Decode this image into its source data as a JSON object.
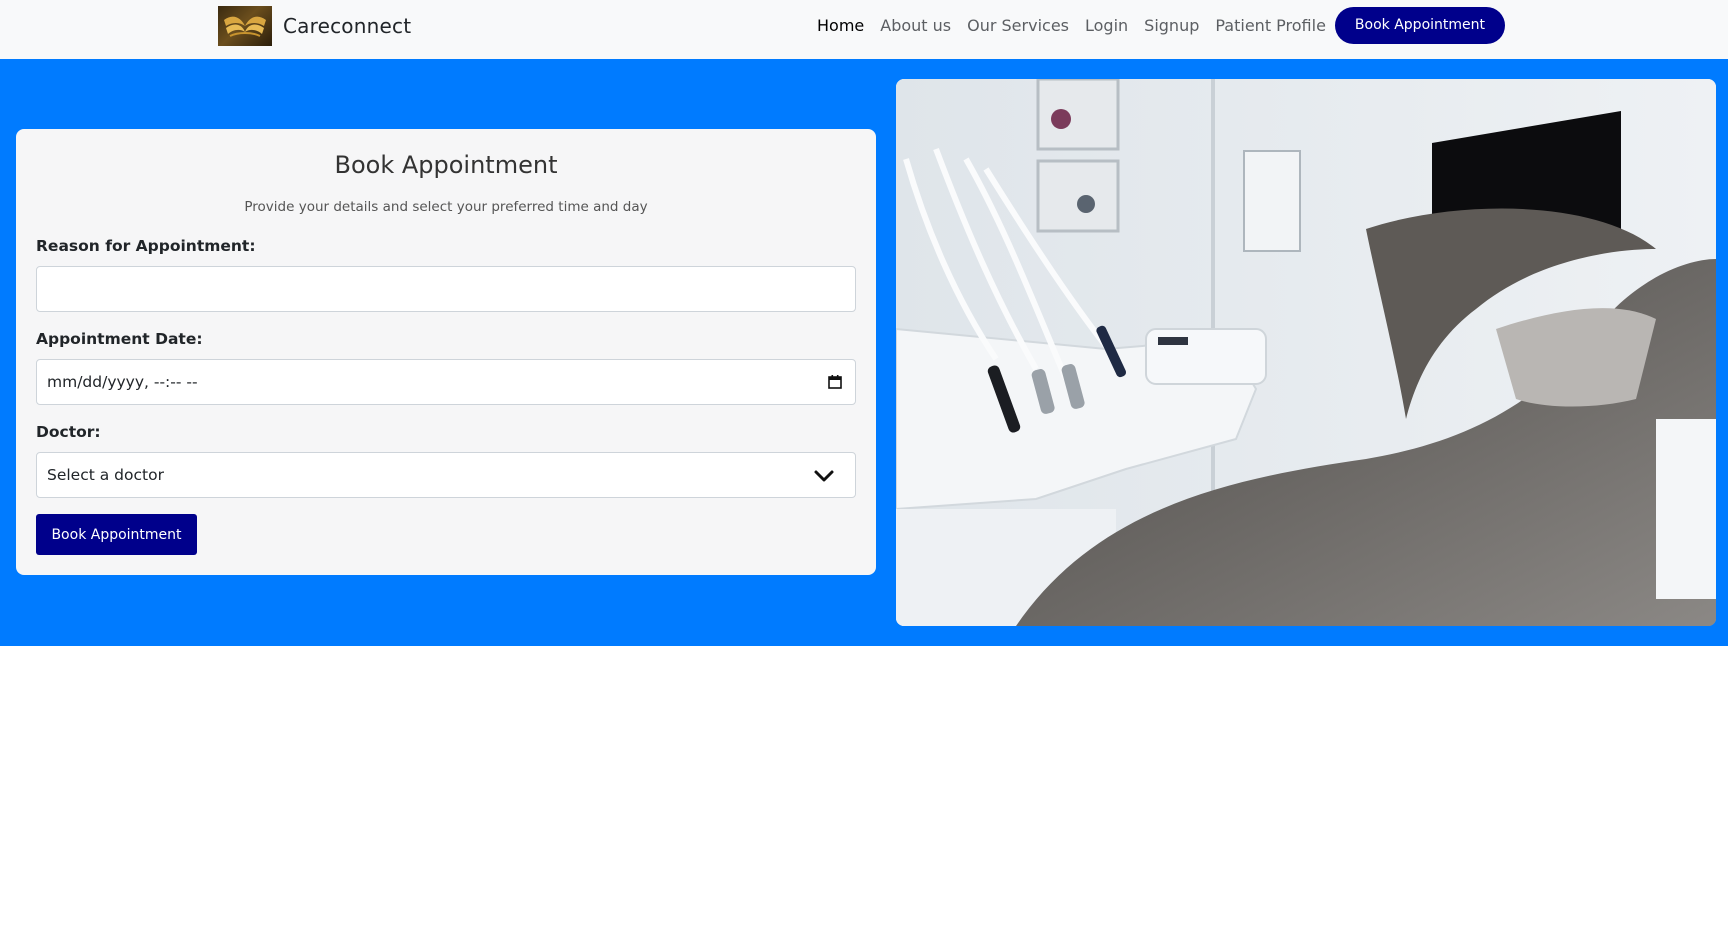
{
  "nav": {
    "brand": "Careconnect",
    "links": [
      "Home",
      "About us",
      "Our Services",
      "Login",
      "Signup",
      "Patient Profile"
    ],
    "book_label": "Book Appointment"
  },
  "form": {
    "title": "Book Appointment",
    "subtitle": "Provide your details and select your preferred time and day",
    "reason_label": "Reason for Appointment:",
    "reason_value": "",
    "date_label": "Appointment Date:",
    "date_value": "mm/dd/yyyy, --:-- --",
    "doctor_label": "Doctor:",
    "doctor_value": "Select a doctor",
    "submit_label": "Book Appointment"
  },
  "colors": {
    "hero_bg": "#007bff",
    "primary_button": "#00008b",
    "navbar_bg": "#f8f9fa"
  },
  "icons": [
    "brand-logo",
    "calendar-icon",
    "chevron-down-icon"
  ]
}
